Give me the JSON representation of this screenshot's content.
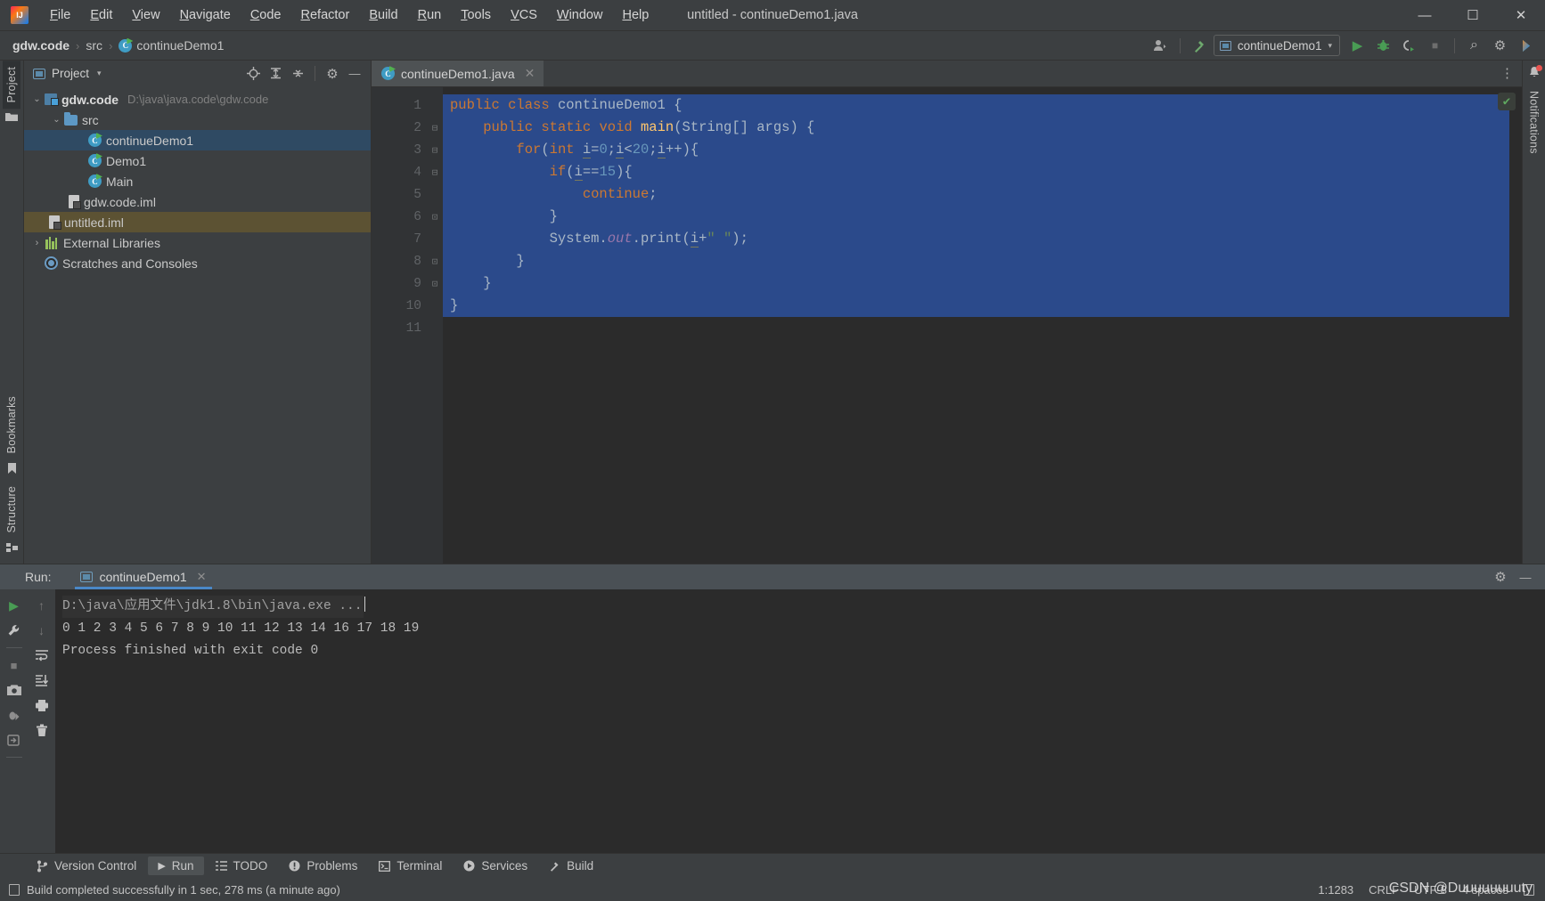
{
  "window": {
    "title": "untitled - continueDemo1.java",
    "minimize": "—",
    "maximize": "☐",
    "close": "✕"
  },
  "menu": [
    {
      "label": "File"
    },
    {
      "label": "Edit"
    },
    {
      "label": "View"
    },
    {
      "label": "Navigate"
    },
    {
      "label": "Code"
    },
    {
      "label": "Refactor"
    },
    {
      "label": "Build"
    },
    {
      "label": "Run"
    },
    {
      "label": "Tools"
    },
    {
      "label": "VCS"
    },
    {
      "label": "Window"
    },
    {
      "label": "Help"
    }
  ],
  "breadcrumb": {
    "project": "gdw.code",
    "folder": "src",
    "file": "continueDemo1",
    "separator": "›"
  },
  "toolbar": {
    "run_config": "continueDemo1",
    "dropdown_caret": "▾",
    "user_icon": "user-icon",
    "build_icon": "hammer-icon",
    "run_icon": "▶",
    "debug_icon": "debug-icon",
    "coverage_icon": "coverage-icon",
    "stop_icon": "■",
    "search_icon": "⌕",
    "settings_icon": "⚙",
    "plugin_icon": "ide-helper-icon"
  },
  "left_strip": {
    "project_tab": "Project",
    "bookmarks_tab": "Bookmarks",
    "structure_tab": "Structure"
  },
  "right_strip": {
    "notifications_tab": "Notifications"
  },
  "project_panel": {
    "title": "Project",
    "caret": "▾",
    "actions": {
      "locate": "crosshair-icon",
      "expand_all": "expand-all-icon",
      "collapse_all": "collapse-all-icon",
      "settings": "⚙",
      "hide": "—"
    },
    "tree": [
      {
        "label": "gdw.code",
        "path": "D:\\java\\java.code\\gdw.code",
        "icon": "module-icon",
        "indent": 0,
        "arrow": "⌄",
        "bold": true,
        "state": "normal"
      },
      {
        "label": "src",
        "path": "",
        "icon": "folder-icon",
        "indent": 1,
        "arrow": "⌄",
        "bold": false,
        "state": "normal"
      },
      {
        "label": "continueDemo1",
        "path": "",
        "icon": "java-class-icon",
        "indent": 2,
        "arrow": "",
        "bold": false,
        "state": "selected"
      },
      {
        "label": "Demo1",
        "path": "",
        "icon": "java-class-icon",
        "indent": 2,
        "arrow": "",
        "bold": false,
        "state": "normal"
      },
      {
        "label": "Main",
        "path": "",
        "icon": "java-class-icon",
        "indent": 2,
        "arrow": "",
        "bold": false,
        "state": "normal"
      },
      {
        "label": "gdw.code.iml",
        "path": "",
        "icon": "iml-file-icon",
        "indent": 1,
        "arrow": "",
        "bold": false,
        "state": "normal"
      },
      {
        "label": "untitled.iml",
        "path": "",
        "icon": "iml-file-icon",
        "indent": 0,
        "arrow": "",
        "bold": false,
        "state": "modified"
      },
      {
        "label": "External Libraries",
        "path": "",
        "icon": "library-icon",
        "indent": 0,
        "arrow": "›",
        "bold": false,
        "state": "normal"
      },
      {
        "label": "Scratches and Consoles",
        "path": "",
        "icon": "scratch-icon",
        "indent": 0,
        "arrow": "",
        "bold": false,
        "state": "normal"
      }
    ]
  },
  "editor": {
    "tab_label": "continueDemo1.java",
    "tab_close": "✕",
    "more_actions": "⋮",
    "inspection_status": "✔",
    "line_numbers": [
      "1",
      "2",
      "3",
      "4",
      "5",
      "6",
      "7",
      "8",
      "9",
      "10",
      "11"
    ],
    "run_markers": [
      1,
      2
    ],
    "code_lines": [
      "public class continueDemo1 {",
      "    public static void main(String[] args) {",
      "        for(int i=0;i<20;i++){",
      "            if(i==15){",
      "                continue;",
      "            }",
      "            System.out.print(i+\" \");",
      "        }",
      "    }",
      "}",
      ""
    ]
  },
  "run_panel": {
    "label": "Run:",
    "tab": "continueDemo1",
    "tab_close": "✕",
    "settings_icon": "⚙",
    "hide_icon": "—",
    "toolbar_icons": {
      "rerun": "▶",
      "wrench": "wrench-icon",
      "stop": "■",
      "camera": "camera-icon",
      "dump": "thread-dump-icon",
      "export_down": "export-icon",
      "up": "↑",
      "down": "↓",
      "soft_wrap": "soft-wrap-icon",
      "scroll_end": "scroll-to-end-icon",
      "print": "print-icon",
      "trash": "trash-icon"
    },
    "console": [
      "D:\\java\\应用文件\\jdk1.8\\bin\\java.exe ...",
      "0 1 2 3 4 5 6 7 8 9 10 11 12 13 14 16 17 18 19",
      "Process finished with exit code 0"
    ]
  },
  "bottom_tabs": [
    {
      "label": "Version Control",
      "icon": "branch-icon",
      "active": false
    },
    {
      "label": "Run",
      "icon": "▶",
      "active": true
    },
    {
      "label": "TODO",
      "icon": "list-icon",
      "active": false
    },
    {
      "label": "Problems",
      "icon": "warning-icon",
      "active": false
    },
    {
      "label": "Terminal",
      "icon": "terminal-icon",
      "active": false
    },
    {
      "label": "Services",
      "icon": "services-icon",
      "active": false
    },
    {
      "label": "Build",
      "icon": "hammer-icon",
      "active": false
    }
  ],
  "status_bar": {
    "message": "Build completed successfully in 1 sec, 278 ms (a minute ago)",
    "caret_position": "1:1283",
    "line_separator": "CRLF",
    "encoding": "UTF-8",
    "indent": "4 spaces",
    "watermark": "CSDN @Duuuuuuuuty"
  },
  "colors": {
    "accent": "#4a88c7",
    "keyword": "#cc7832",
    "number": "#6897bb",
    "method": "#ffc66d",
    "string": "#6a8759",
    "selection": "#2b4a8b",
    "success": "#499c54"
  }
}
